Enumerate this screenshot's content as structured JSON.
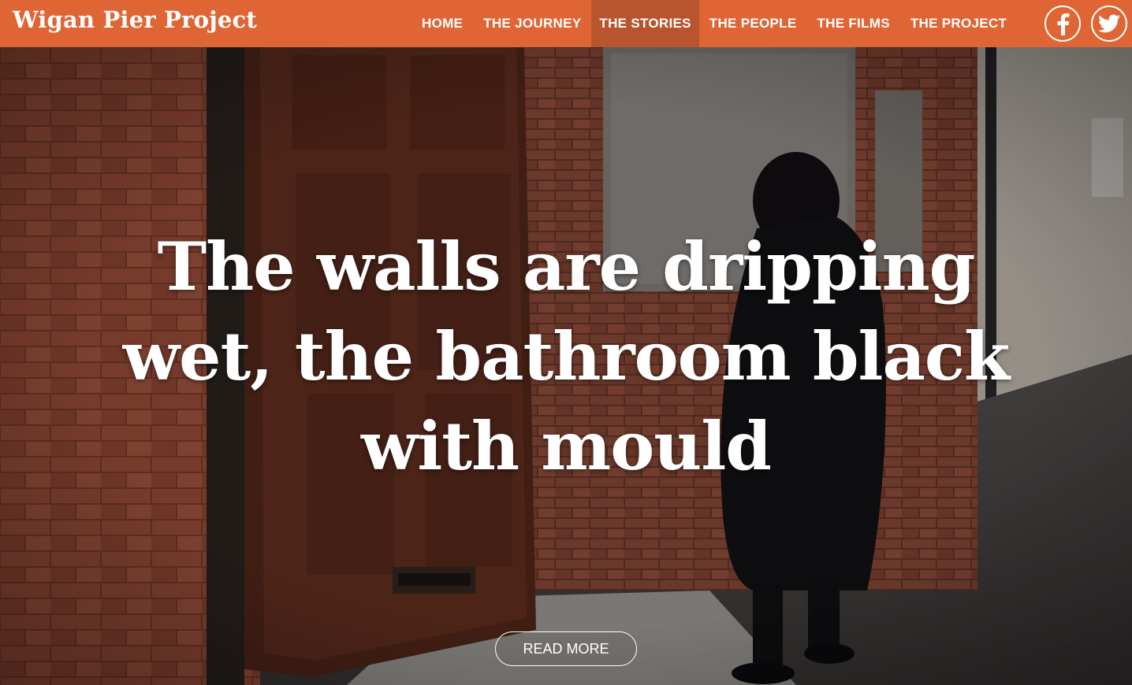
{
  "header": {
    "brand": "Wigan Pier Project",
    "nav": [
      {
        "label": "HOME",
        "active": false
      },
      {
        "label": "THE JOURNEY",
        "active": false
      },
      {
        "label": "THE STORIES",
        "active": true
      },
      {
        "label": "THE PEOPLE",
        "active": false
      },
      {
        "label": "THE FILMS",
        "active": false
      },
      {
        "label": "THE PROJECT",
        "active": false
      }
    ],
    "social": [
      {
        "icon": "facebook-icon"
      },
      {
        "icon": "twitter-icon"
      }
    ]
  },
  "hero": {
    "headline": "The walls are dripping wet, the bathroom black with mould",
    "cta_label": "READ MORE"
  },
  "colors": {
    "header_bg": "#e06535",
    "nav_active_bg": "#b8552f",
    "text": "#ffffff"
  }
}
